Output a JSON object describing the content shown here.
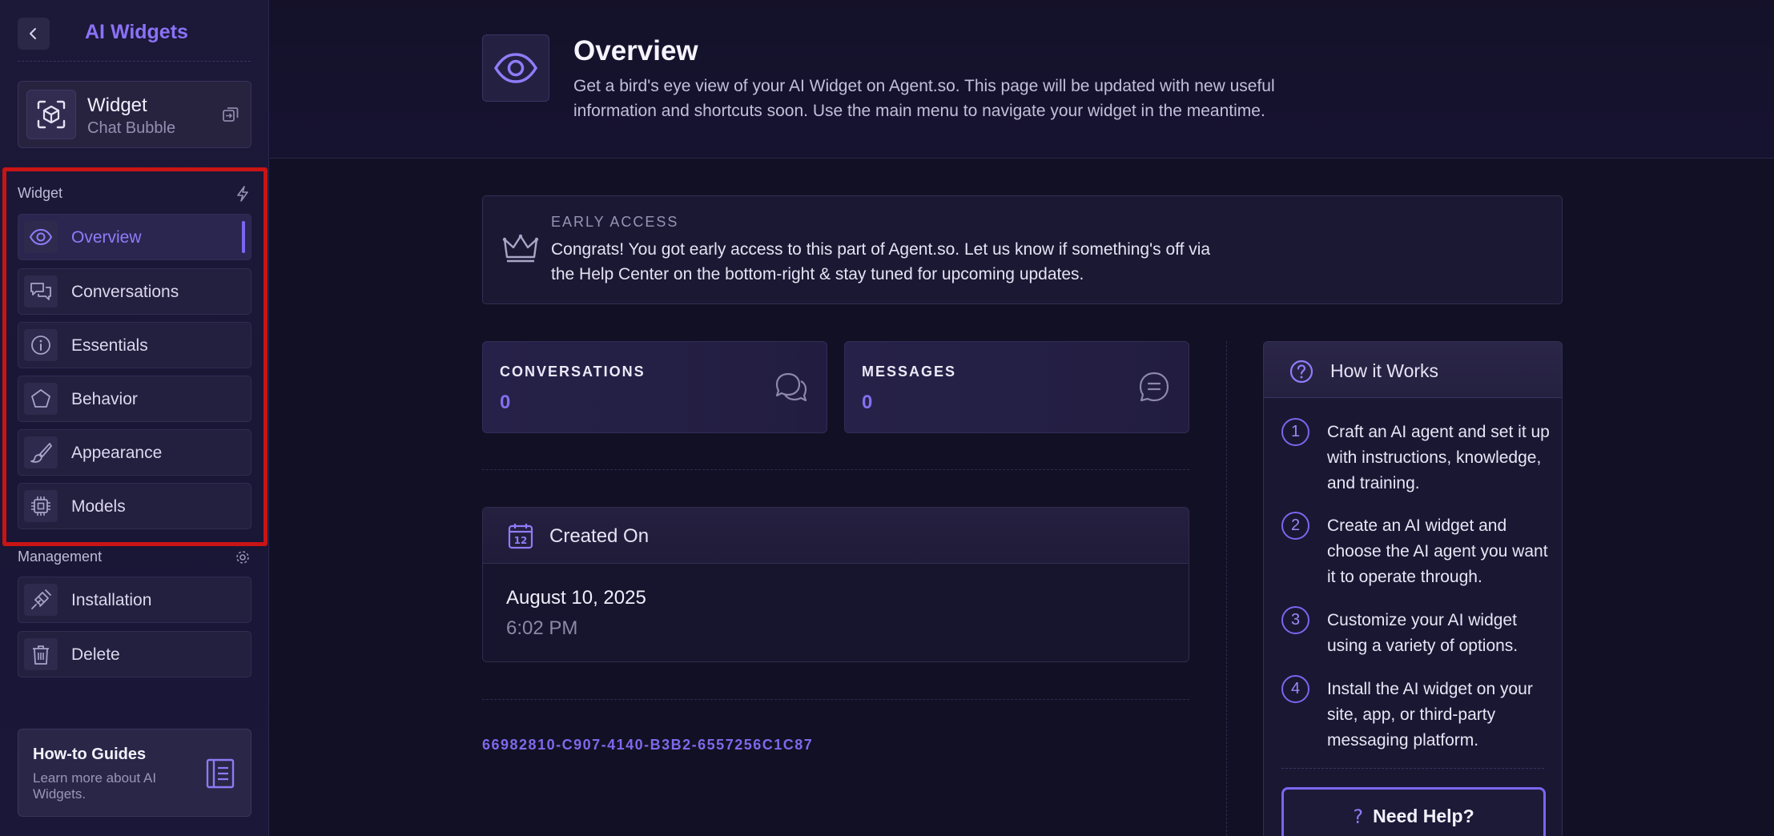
{
  "sidebar": {
    "app_title": "AI Widgets",
    "widget": {
      "name": "Widget",
      "type": "Chat Bubble"
    },
    "sections": [
      {
        "label": "Widget",
        "items": [
          {
            "label": "Overview",
            "icon": "eye-icon",
            "active": true
          },
          {
            "label": "Conversations",
            "icon": "chat-bubbles-icon"
          },
          {
            "label": "Essentials",
            "icon": "info-icon"
          },
          {
            "label": "Behavior",
            "icon": "pentagon-icon"
          },
          {
            "label": "Appearance",
            "icon": "paintbrush-icon"
          },
          {
            "label": "Models",
            "icon": "chip-icon"
          }
        ]
      },
      {
        "label": "Management",
        "items": [
          {
            "label": "Installation",
            "icon": "plug-icon"
          },
          {
            "label": "Delete",
            "icon": "trash-icon"
          }
        ]
      }
    ],
    "guide": {
      "title": "How-to Guides",
      "subtitle": "Learn more about AI Widgets."
    }
  },
  "header": {
    "title": "Overview",
    "description": "Get a bird's eye view of your AI Widget on Agent.so. This page will be updated with new useful information and shortcuts soon. Use the main menu to navigate your widget in the meantime."
  },
  "early_access": {
    "title": "EARLY ACCESS",
    "text": "Congrats! You got early access to this part of Agent.so. Let us know if something's off via the Help Center on the bottom-right & stay tuned for upcoming updates."
  },
  "stats": [
    {
      "label": "CONVERSATIONS",
      "value": "0",
      "icon": "chat-bubbles-icon"
    },
    {
      "label": "MESSAGES",
      "value": "0",
      "icon": "message-icon"
    }
  ],
  "created": {
    "title": "Created On",
    "date": "August 10, 2025",
    "time": "6:02 PM",
    "calendar_day": "12"
  },
  "widget_id": "66982810-C907-4140-B3B2-6557256C1C87",
  "how_it_works": {
    "title": "How it Works",
    "steps": [
      {
        "num": "1",
        "text": "Craft an AI agent and set it up with instructions, knowledge, and training."
      },
      {
        "num": "2",
        "text": "Create an AI widget and choose the AI agent you want it to operate through."
      },
      {
        "num": "3",
        "text": "Customize your AI widget using a variety of options."
      },
      {
        "num": "4",
        "text": "Install the AI widget on your site, app, or third-party messaging platform."
      }
    ],
    "help_button": "Need Help?",
    "help_icon": "?"
  },
  "colors": {
    "accent": "#7b66f0",
    "background": "#121024",
    "highlight": "#c81414"
  }
}
